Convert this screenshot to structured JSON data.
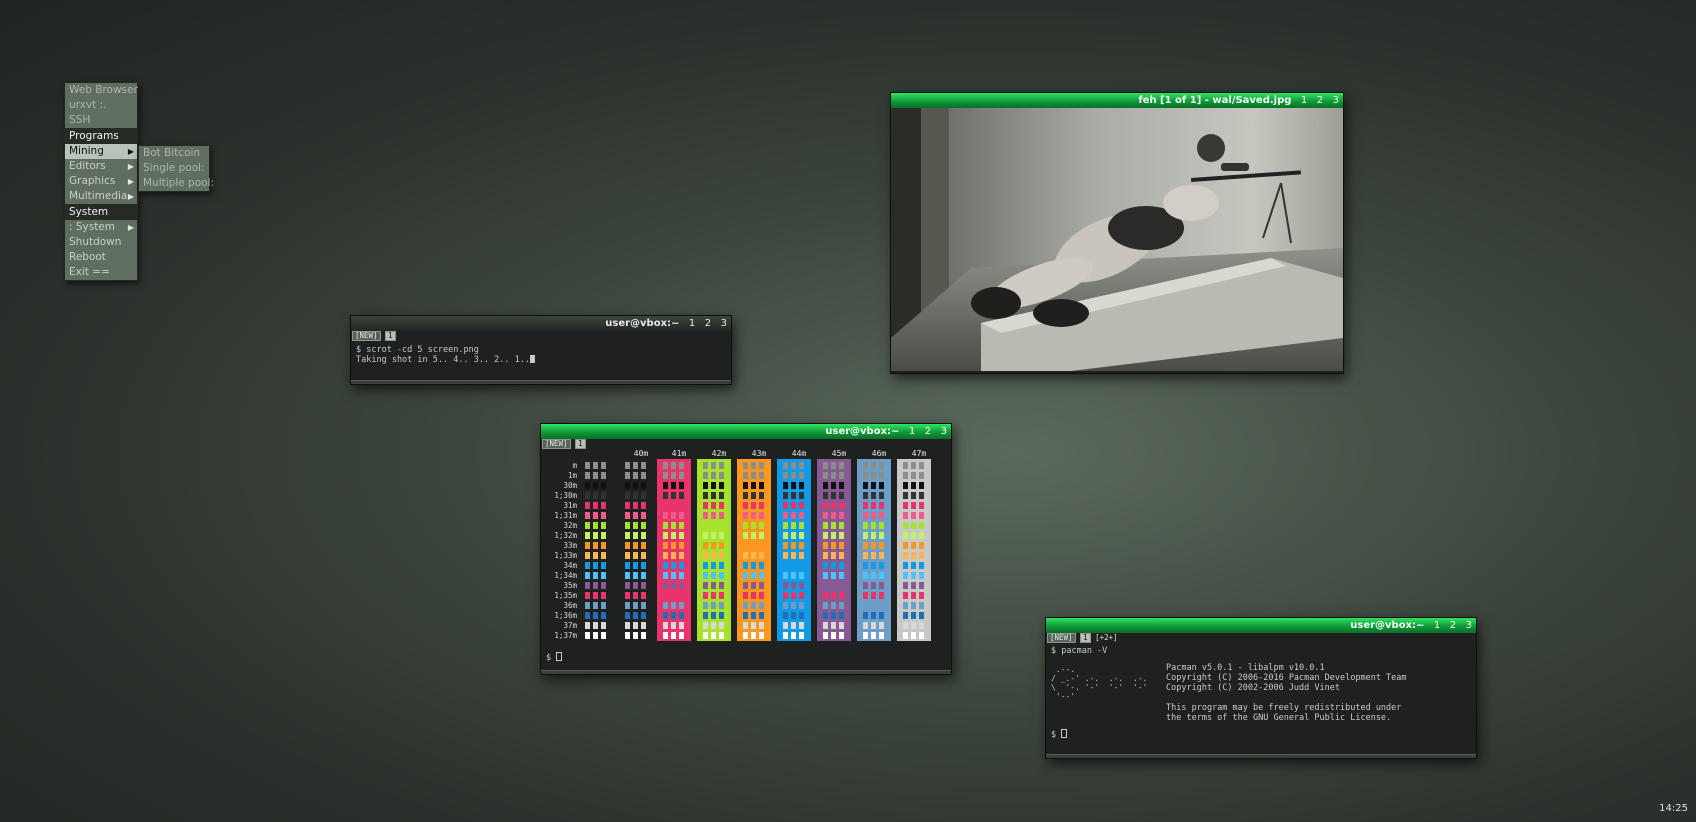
{
  "menu": {
    "items": [
      {
        "label": "Web Browser",
        "type": "item"
      },
      {
        "label": "urxvt :.",
        "type": "item"
      },
      {
        "label": "SSH",
        "type": "item"
      },
      {
        "label": "Programs",
        "type": "header"
      },
      {
        "label": "Mining",
        "type": "submenu",
        "highlighted": true
      },
      {
        "label": "Editors",
        "type": "submenu"
      },
      {
        "label": "Graphics",
        "type": "submenu"
      },
      {
        "label": "Multimedia",
        "type": "submenu"
      },
      {
        "label": "System",
        "type": "header"
      },
      {
        "label": ": System",
        "type": "submenu"
      },
      {
        "label": "Shutdown",
        "type": "item"
      },
      {
        "label": "Reboot",
        "type": "item"
      },
      {
        "label": "Exit ==",
        "type": "item"
      }
    ],
    "submenu": {
      "items": [
        "Bot Bitcoin",
        "Single pool:",
        "Multiple pool:"
      ]
    }
  },
  "feh_window": {
    "title": "feh [1 of 1] - wal/Saved.jpg",
    "workspaces": [
      "1",
      "2",
      "3"
    ],
    "image_icon": "photo-sniper-on-floor"
  },
  "scrot_terminal": {
    "title": "user@vbox:~",
    "workspaces": [
      "1",
      "2",
      "3"
    ],
    "tabs": [
      "[NEW]",
      "1"
    ],
    "lines": [
      "$ scrot -cd 5 screen.png",
      "Taking shot in 5.. 4.. 3.. 2.. 1.."
    ]
  },
  "colors_terminal": {
    "title": "user@vbox:~",
    "workspaces": [
      "1",
      "2",
      "3"
    ],
    "tabs": [
      "[NEW]",
      "1"
    ],
    "col_headers": [
      "",
      "",
      "40m",
      "41m",
      "42m",
      "43m",
      "44m",
      "45m",
      "46m",
      "47m"
    ],
    "row_labels": [
      "m",
      "1m",
      "30m",
      "1;30m",
      "31m",
      "1;31m",
      "32m",
      "1;32m",
      "33m",
      "1;33m",
      "34m",
      "1;34m",
      "35m",
      "1;35m",
      "36m",
      "1;36m",
      "37m",
      "1;37m"
    ],
    "bg_colors": [
      "#e8336b",
      "#a6e22e",
      "#fd971f",
      "#129ae6",
      "#875a94",
      "#6d9ec7",
      "#c7c9c7"
    ],
    "fg_colors": [
      "#8a8f8a",
      "#8a8f8a",
      "#111111",
      "#333333",
      "#e8336b",
      "#f05c8a",
      "#a6e22e",
      "#c3f267",
      "#fd971f",
      "#ffb454",
      "#129ae6",
      "#4fc1ff",
      "#875a94",
      "#e8336b",
      "#6d9ec7",
      "#1f6fb8",
      "#d8d8d8",
      "#ffffff"
    ],
    "prompt": "$"
  },
  "pacman_terminal": {
    "title": "user@vbox:~",
    "workspaces": [
      "1",
      "2",
      "3"
    ],
    "tabs": [
      "[NEW]",
      "1",
      "[+2+]"
    ],
    "command": "$ pacman -V",
    "ascii_art": " .--.\n/ _.-' .-.  .-.  .-.\n\\  '-. '-'  '-'  '-'\n '--'",
    "info": [
      "Pacman v5.0.1 - libalpm v10.0.1",
      "Copyright (C) 2006-2016 Pacman Development Team",
      "Copyright (C) 2002-2006 Judd Vinet",
      "",
      "This program may be freely redistributed under",
      "the terms of the GNU General Public License."
    ],
    "prompt": "$"
  },
  "clock": "14:25"
}
